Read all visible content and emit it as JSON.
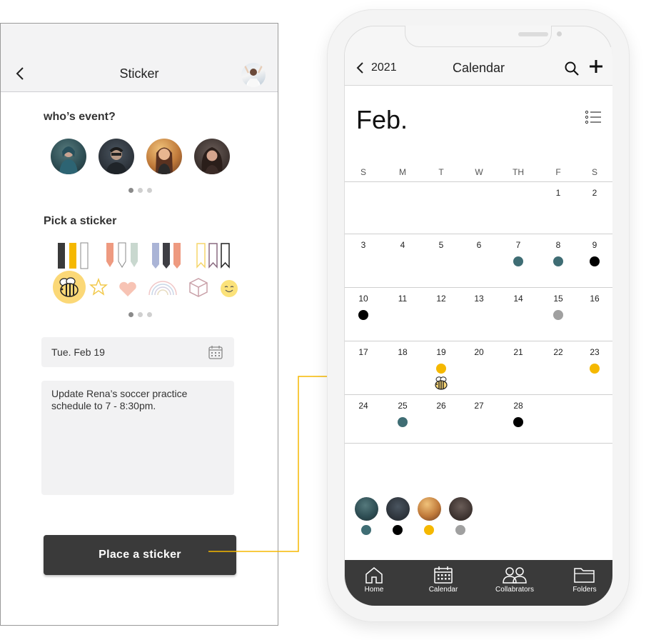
{
  "colors": {
    "teal": "#3f6d74",
    "black": "#000000",
    "yellow": "#f5b800",
    "gray": "#a0a0a0",
    "dark_button": "#3a3a3a",
    "bee_highlight": "#fbd877"
  },
  "left": {
    "header": {
      "title": "Sticker",
      "back_icon": "chevron-left-icon",
      "avatar_icon": "user-avatar"
    },
    "who_label": "who’s event?",
    "people": [
      "person-1-avatar",
      "person-2-avatar",
      "person-3-avatar",
      "person-4-avatar"
    ],
    "pick_label": "Pick a sticker",
    "stickers_row1": [
      "bookmark-black-yellow-white-icon",
      "arrow-salmon-white-green-icon",
      "bookmark-lavender-charcoal-salmon-icon",
      "bookmark-outline-icon"
    ],
    "stickers_row2": [
      "bee-icon",
      "star-icon",
      "heart-icon",
      "rainbow-icon",
      "box-icon",
      "smiley-icon"
    ],
    "date_value": "Tue. Feb 19",
    "note_value": "Update Rena’s soccer practice schedule to 7 - 8:30pm.",
    "place_button": "Place a sticker"
  },
  "phone": {
    "year": "2021",
    "title": "Calendar",
    "month": "Feb.",
    "weekdays": [
      "S",
      "M",
      "T",
      "W",
      "TH",
      "F",
      "S"
    ],
    "weeks": [
      [
        "",
        "",
        "",
        "",
        "",
        "1",
        "2"
      ],
      [
        "3",
        "4",
        "5",
        "6",
        "7",
        "8",
        "9"
      ],
      [
        "10",
        "11",
        "12",
        "13",
        "14",
        "15",
        "16"
      ],
      [
        "17",
        "18",
        "19",
        "20",
        "21",
        "22",
        "23"
      ],
      [
        "24",
        "25",
        "26",
        "27",
        "28",
        "",
        ""
      ]
    ],
    "events": [
      {
        "day": "7",
        "color": "teal"
      },
      {
        "day": "8",
        "color": "teal"
      },
      {
        "day": "9",
        "color": "black"
      },
      {
        "day": "10",
        "color": "black"
      },
      {
        "day": "15",
        "color": "gray"
      },
      {
        "day": "19",
        "color": "yellow",
        "sticker": "bee-icon"
      },
      {
        "day": "23",
        "color": "yellow"
      },
      {
        "day": "25",
        "color": "teal"
      },
      {
        "day": "28",
        "color": "black"
      }
    ],
    "legend": [
      {
        "avatar": "person-1-avatar",
        "color": "teal"
      },
      {
        "avatar": "person-2-avatar",
        "color": "black"
      },
      {
        "avatar": "person-3-avatar",
        "color": "yellow"
      },
      {
        "avatar": "person-4-avatar",
        "color": "gray"
      }
    ],
    "tabs": [
      {
        "label": "Home",
        "icon": "home-icon"
      },
      {
        "label": "Calendar",
        "icon": "calendar-icon"
      },
      {
        "label": "Collabrators",
        "icon": "collaborators-icon"
      },
      {
        "label": "Folders",
        "icon": "folder-icon"
      }
    ]
  }
}
